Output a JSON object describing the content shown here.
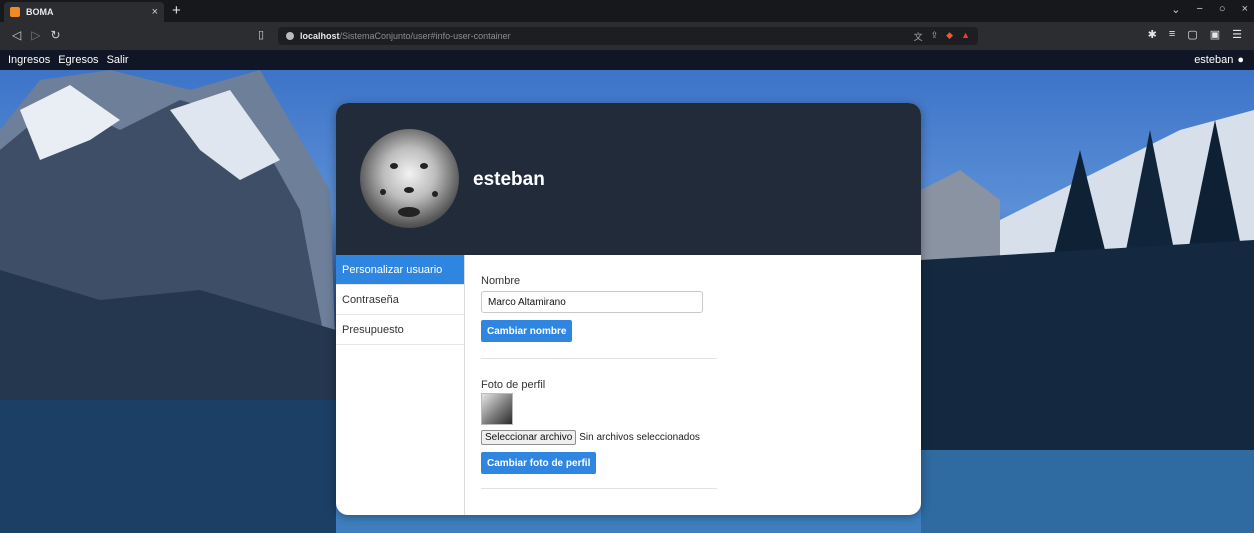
{
  "browser": {
    "tab_title": "BOMA",
    "tab_close": "×",
    "new_tab": "+",
    "url_host": "localhost",
    "url_path": "/SistemaConjunto/user#info-user-container",
    "window_controls": [
      "⌄",
      "−",
      "○",
      "×"
    ]
  },
  "appnav": {
    "links": [
      "Ingresos",
      "Egresos",
      "Salir"
    ],
    "user": "esteban"
  },
  "profile": {
    "username": "esteban"
  },
  "sidebar": {
    "items": [
      {
        "label": "Personalizar usuario",
        "active": true
      },
      {
        "label": "Contraseña",
        "active": false
      },
      {
        "label": "Presupuesto",
        "active": false
      }
    ]
  },
  "form": {
    "name_label": "Nombre",
    "name_value": "Marco Altamirano",
    "change_name_button": "Cambiar nombre",
    "photo_label": "Foto de perfil",
    "file_button": "Seleccionar archivo",
    "file_status": "Sin archivos seleccionados",
    "change_photo_button": "Cambiar foto de perfil"
  },
  "colors": {
    "accent": "#2f86e0",
    "card_header": "#222b3a",
    "appnav_bg": "#101626"
  }
}
